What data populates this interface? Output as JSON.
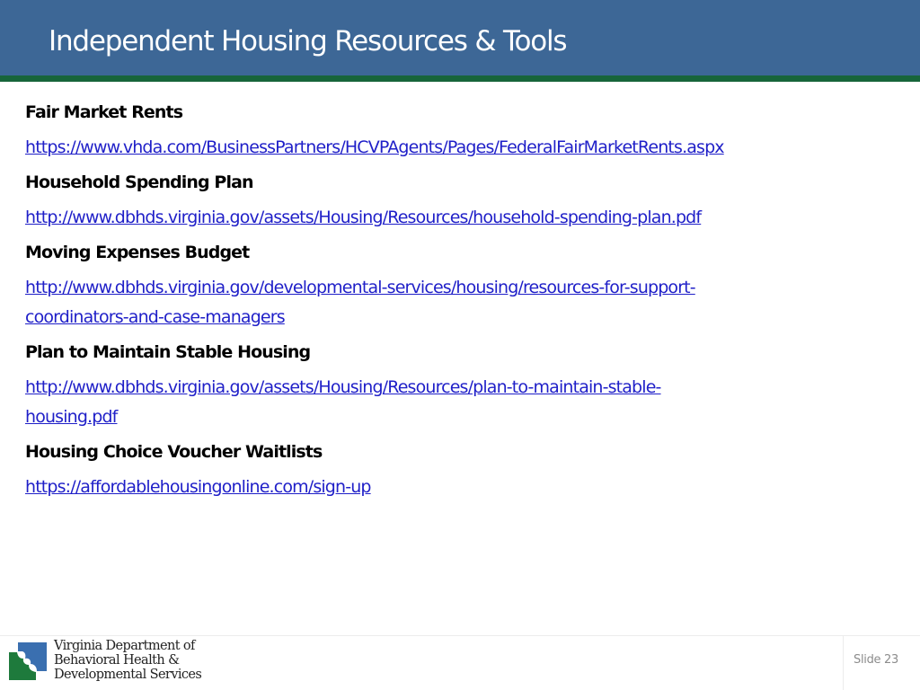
{
  "header": {
    "title": "Independent Housing Resources & Tools",
    "background_color": "#3d6796",
    "accent_bar_color": "#17653a"
  },
  "resources": [
    {
      "heading": "Fair Market Rents",
      "link_lines": [
        "https://www.vhda.com/BusinessPartners/HCVPAgents/Pages/FederalFairMarketRents.aspx"
      ]
    },
    {
      "heading": "Household Spending Plan",
      "link_lines": [
        "http://www.dbhds.virginia.gov/assets/Housing/Resources/household-spending-plan.pdf"
      ]
    },
    {
      "heading": "Moving Expenses Budget",
      "link_lines": [
        "http://www.dbhds.virginia.gov/developmental-services/housing/resources-for-support-",
        "coordinators-and-case-managers"
      ]
    },
    {
      "heading": "Plan to Maintain Stable Housing",
      "link_lines": [
        "http://www.dbhds.virginia.gov/assets/Housing/Resources/plan-to-maintain-stable-",
        "housing.pdf"
      ]
    },
    {
      "heading": "Housing Choice Voucher Waitlists",
      "link_lines": [
        "https://affordablehousingonline.com/sign-up"
      ]
    }
  ],
  "footer": {
    "logo_icon": "dbhds-logo-icon",
    "logo_lines": [
      "Virginia Department of",
      "Behavioral Health &",
      "Developmental Services"
    ],
    "slide_label": "Slide 23"
  },
  "colors": {
    "link": "#1f1fc8",
    "logo_blue": "#3a6fb0",
    "logo_green": "#1e7a3c"
  }
}
